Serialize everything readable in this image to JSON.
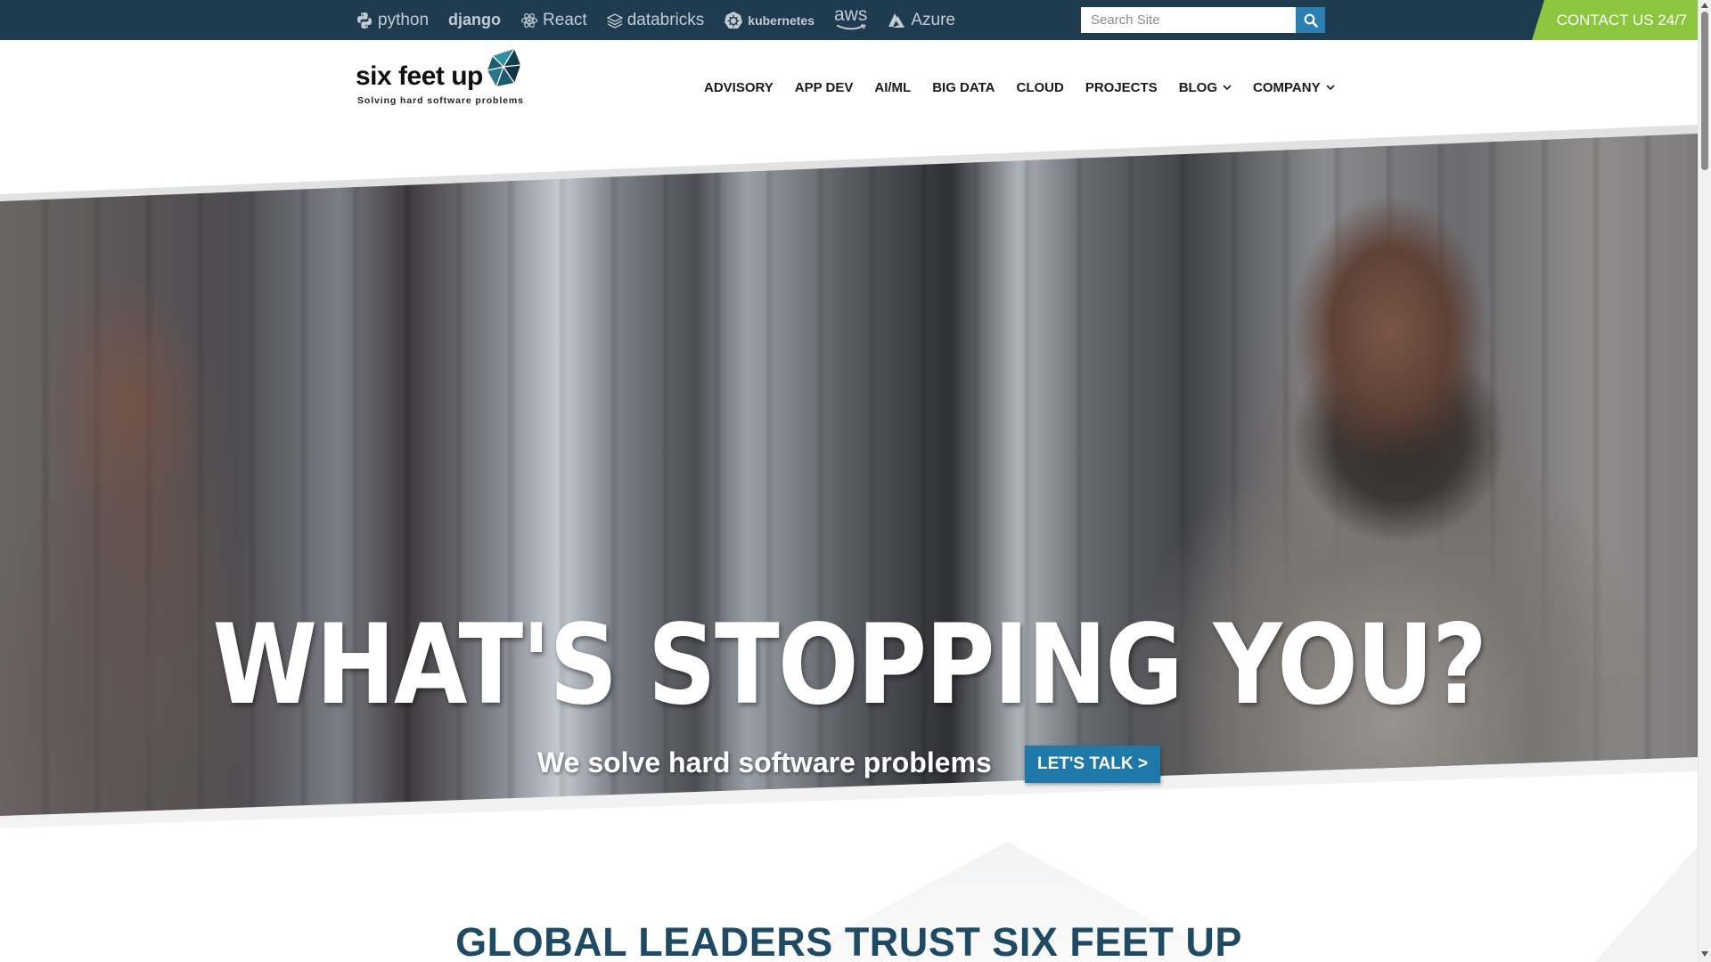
{
  "topbar": {
    "technologies": [
      "python",
      "django",
      "React",
      "databricks",
      "kubernetes",
      "aws",
      "Azure"
    ],
    "search": {
      "placeholder": "Search Site",
      "value": ""
    },
    "contact_label": "CONTACT US 24/7"
  },
  "header": {
    "logo": {
      "name": "six feet up",
      "tagline": "Solving hard software problems"
    },
    "nav": [
      "ADVISORY",
      "APP DEV",
      "AI/ML",
      "BIG DATA",
      "CLOUD",
      "PROJECTS",
      "BLOG",
      "COMPANY"
    ]
  },
  "hero": {
    "title": "WHAT'S STOPPING YOU?",
    "subtitle": "We solve hard software problems",
    "cta": "LET'S TALK >"
  },
  "section": {
    "title": "GLOBAL LEADERS TRUST SIX FEET UP"
  },
  "colors": {
    "topbar_bg": "#1e3b4f",
    "contact_bg": "#8cc63f",
    "accent_blue": "#1f79a8",
    "heading_blue": "#1e4a64"
  },
  "icons": [
    "python-icon",
    "react-icon",
    "databricks-icon",
    "kubernetes-icon",
    "aws-smile-icon",
    "azure-icon",
    "search-icon",
    "chevron-down-icon",
    "six-feet-up-logo-mark"
  ]
}
